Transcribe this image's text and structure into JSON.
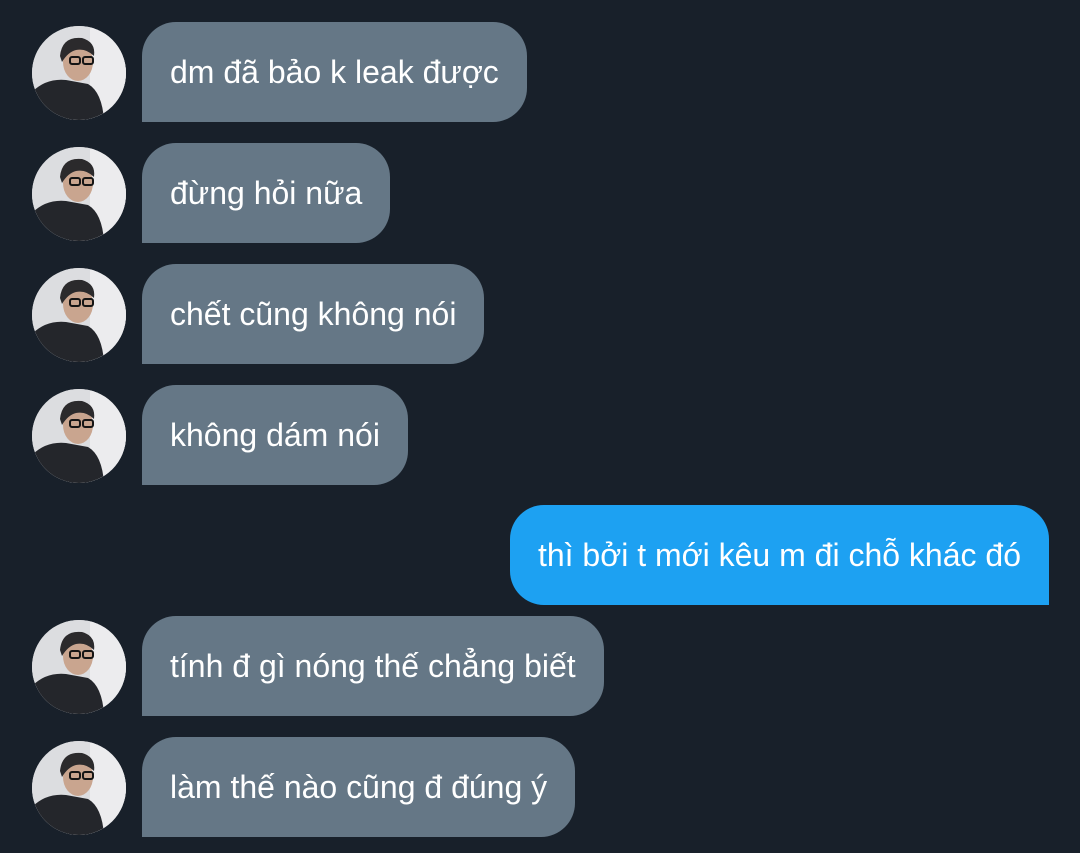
{
  "chat": {
    "messages": [
      {
        "direction": "incoming",
        "text": "dm đã bảo k leak được",
        "avatar": "contact-photo"
      },
      {
        "direction": "incoming",
        "text": "đừng hỏi nữa",
        "avatar": "contact-photo"
      },
      {
        "direction": "incoming",
        "text": "chết cũng không nói",
        "avatar": "contact-photo"
      },
      {
        "direction": "incoming",
        "text": "không dám nói",
        "avatar": "contact-photo"
      },
      {
        "direction": "outgoing",
        "text": "thì bởi t mới kêu m đi chỗ khác đó"
      },
      {
        "direction": "incoming",
        "text": "tính đ gì nóng thế chẳng biết",
        "avatar": "contact-photo"
      },
      {
        "direction": "incoming",
        "text": "làm thế nào cũng đ đúng ý",
        "avatar": "contact-photo"
      }
    ]
  },
  "colors": {
    "background": "#18202a",
    "incoming_bubble": "#657786",
    "outgoing_bubble": "#1da1f2",
    "text": "#ffffff"
  }
}
